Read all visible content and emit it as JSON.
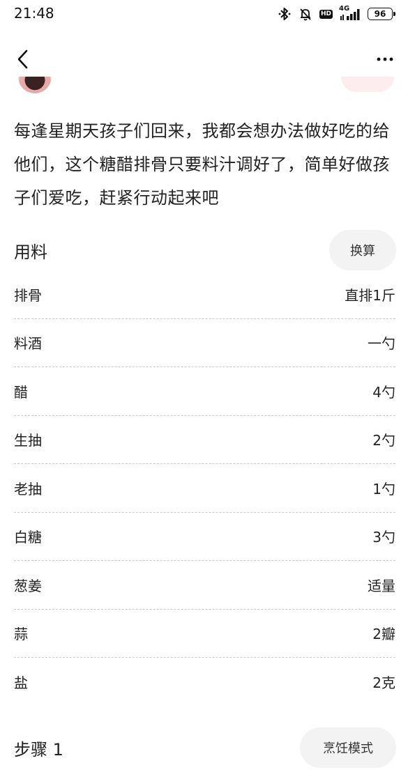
{
  "status_bar": {
    "time": "21:48",
    "network_label": "4G",
    "hd_label": "HD",
    "battery": "96",
    "icons": [
      "bluetooth-icon",
      "mute-bell-icon",
      "hd-icon",
      "signal-icon",
      "battery-icon"
    ]
  },
  "nav": {
    "back_icon": "chevron-left-icon",
    "more_icon": "more-dots-icon"
  },
  "description": "每逢星期天孩子们回来，我都会想办法做好吃的给他们，这个糖醋排骨只要料汁调好了，简单好做孩子们爱吃，赶紧行动起来吧",
  "ingredients_section": {
    "title": "用料",
    "convert_button": "换算",
    "items": [
      {
        "name": "排骨",
        "amount": "直排1斤"
      },
      {
        "name": "料酒",
        "amount": "一勺"
      },
      {
        "name": "醋",
        "amount": "4勺"
      },
      {
        "name": "生抽",
        "amount": "2勺"
      },
      {
        "name": "老抽",
        "amount": "1勺"
      },
      {
        "name": "白糖",
        "amount": "3勺"
      },
      {
        "name": "葱姜",
        "amount": "适量"
      },
      {
        "name": "蒜",
        "amount": "2瓣"
      },
      {
        "name": "盐",
        "amount": "2克"
      }
    ]
  },
  "steps_section": {
    "title": "步骤 1",
    "cooking_mode_button": "烹饪模式"
  },
  "colors": {
    "text": "#222222",
    "pill_bg": "#f3f3f3",
    "divider": "#c9c9c9"
  }
}
